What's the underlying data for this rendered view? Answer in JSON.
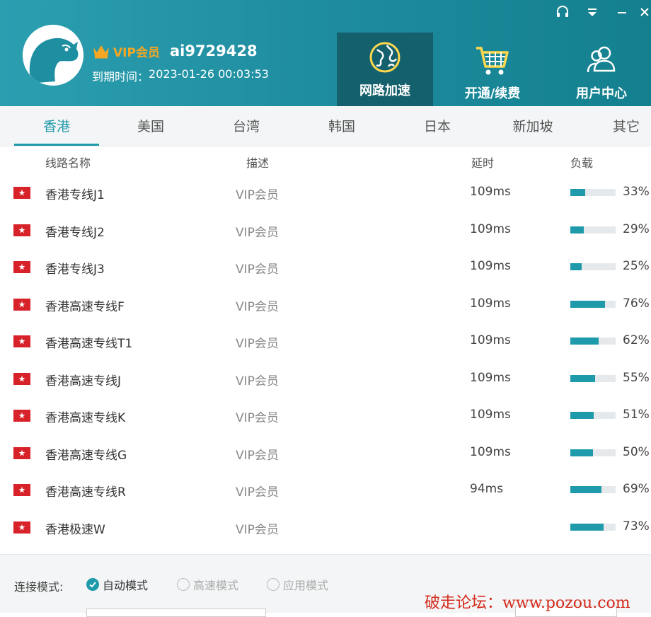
{
  "header": {
    "vip_label": "VIP会员",
    "username": "ai9729428",
    "expire_label": "到期时间：",
    "expire_value": "2023-01-26 00:03:53",
    "nav": [
      {
        "label": "网路加速",
        "icon": "globe-icon",
        "active": true
      },
      {
        "label": "开通/续费",
        "icon": "shopping-cart-icon",
        "active": false
      },
      {
        "label": "用户中心",
        "icon": "users-icon",
        "active": false
      }
    ],
    "window_controls": [
      "headset-icon",
      "menu-down-icon",
      "minimize-icon",
      "close-icon"
    ]
  },
  "tabs": [
    "香港",
    "美国",
    "台湾",
    "韩国",
    "日本",
    "新加坡",
    "其它"
  ],
  "active_tab": 0,
  "table": {
    "columns": [
      "线路名称",
      "描述",
      "延时",
      "负载"
    ],
    "rows": [
      {
        "name": "香港专线J1",
        "desc": "VIP会员",
        "latency": "109ms",
        "load": 33,
        "load_text": "33%"
      },
      {
        "name": "香港专线J2",
        "desc": "VIP会员",
        "latency": "109ms",
        "load": 29,
        "load_text": "29%"
      },
      {
        "name": "香港专线J3",
        "desc": "VIP会员",
        "latency": "109ms",
        "load": 25,
        "load_text": "25%"
      },
      {
        "name": "香港高速专线F",
        "desc": "VIP会员",
        "latency": "109ms",
        "load": 76,
        "load_text": "76%"
      },
      {
        "name": "香港高速专线T1",
        "desc": "VIP会员",
        "latency": "109ms",
        "load": 62,
        "load_text": "62%"
      },
      {
        "name": "香港高速专线J",
        "desc": "VIP会员",
        "latency": "109ms",
        "load": 55,
        "load_text": "55%"
      },
      {
        "name": "香港高速专线K",
        "desc": "VIP会员",
        "latency": "109ms",
        "load": 51,
        "load_text": "51%"
      },
      {
        "name": "香港高速专线G",
        "desc": "VIP会员",
        "latency": "109ms",
        "load": 50,
        "load_text": "50%"
      },
      {
        "name": "香港高速专线R",
        "desc": "VIP会员",
        "latency": "94ms",
        "load": 69,
        "load_text": "69%"
      },
      {
        "name": "香港极速W",
        "desc": "VIP会员",
        "latency": "",
        "load": 73,
        "load_text": "73%"
      }
    ]
  },
  "footer": {
    "mode_label": "连接模式:",
    "modes": [
      {
        "label": "自动模式",
        "selected": true
      },
      {
        "label": "高速模式",
        "selected": false
      },
      {
        "label": "应用模式",
        "selected": false
      }
    ],
    "watermark": "破走论坛：www.pozou.com"
  },
  "colors": {
    "accent": "#1e9aab",
    "header_bg": "#1f8ea0",
    "nav_active_bg": "#15606d",
    "vip_gold": "#f5a623",
    "flag_red": "#d8222a",
    "watermark_red": "#d42a1c"
  }
}
